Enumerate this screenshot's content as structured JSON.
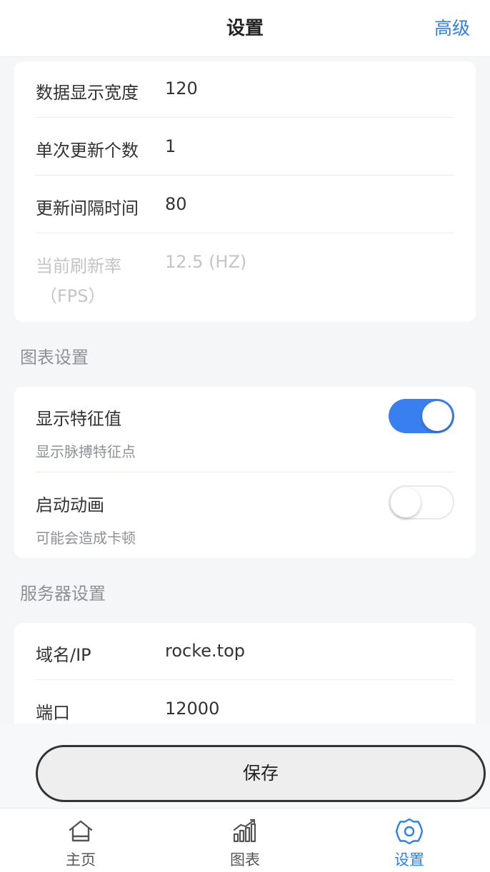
{
  "header": {
    "title": "设置",
    "advanced_label": "高级"
  },
  "data_settings": {
    "rows": [
      {
        "label": "数据显示宽度",
        "value": "120"
      },
      {
        "label": "单次更新个数",
        "value": "1"
      },
      {
        "label": "更新间隔时间",
        "value": "80"
      }
    ],
    "refresh_rate": {
      "label_line1": "当前刷新率",
      "label_line2": "（FPS）",
      "value": "12.5 (HZ)"
    }
  },
  "chart_settings": {
    "section_title": "图表设置",
    "items": [
      {
        "title": "显示特征值",
        "subtitle": "显示脉搏特征点",
        "enabled": true
      },
      {
        "title": "启动动画",
        "subtitle": "可能会造成卡顿",
        "enabled": false
      }
    ]
  },
  "server_settings": {
    "section_title": "服务器设置",
    "rows": [
      {
        "label": "域名/IP",
        "value": "rocke.top"
      },
      {
        "label": "端口",
        "value": "12000"
      }
    ]
  },
  "save_label": "保存",
  "tabbar": {
    "tabs": [
      {
        "label": "主页",
        "icon": "home-icon",
        "active": false
      },
      {
        "label": "图表",
        "icon": "chart-icon",
        "active": false
      },
      {
        "label": "设置",
        "icon": "gear-icon",
        "active": true
      }
    ]
  },
  "colors": {
    "accent": "#2f80ed",
    "toggle_on": "#3a7ff0",
    "background": "#f5f6f8",
    "muted_text": "#8d9197"
  }
}
